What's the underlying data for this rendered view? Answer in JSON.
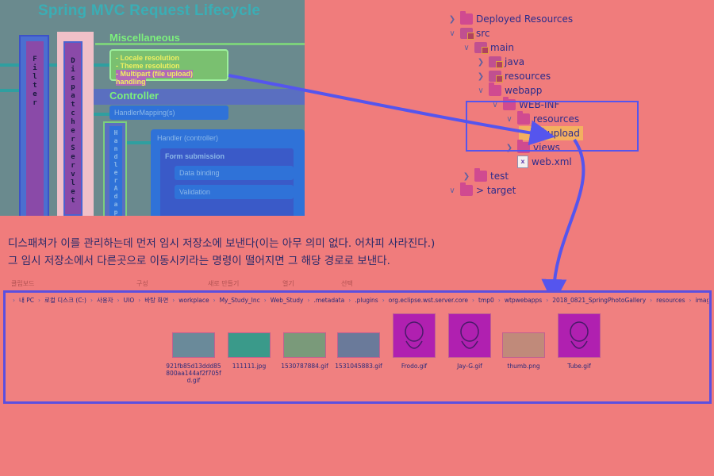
{
  "diagram": {
    "title": "Spring MVC Request Lifecycle",
    "filter_label": "Filter",
    "dispatcher_label": "DispatcherServlet",
    "misc_heading": "Miscellaneous",
    "misc_items": [
      "- Locale resolution",
      "- Theme resolution",
      "- Multipart (file upload) handling"
    ],
    "controller_heading": "Controller",
    "handler_mapping": "HandlerMapping(s)",
    "handler_adapter": "HandlerAdapter",
    "handler_controller": "Handler (controller)",
    "form_submission": "Form submission",
    "data_binding": "Data binding",
    "validation": "Validation"
  },
  "tree": {
    "items": [
      {
        "label": "Deployed Resources",
        "twisty": ">",
        "icon": "folder-icon"
      },
      {
        "label": "src",
        "twisty": "v",
        "icon": "package-folder-icon"
      },
      {
        "label": "main",
        "twisty": "v",
        "icon": "package-folder-icon"
      },
      {
        "label": "java",
        "twisty": ">",
        "icon": "package-folder-icon"
      },
      {
        "label": "resources",
        "twisty": ">",
        "icon": "package-folder-icon"
      },
      {
        "label": "webapp",
        "twisty": "v",
        "icon": "folder-icon"
      },
      {
        "label": "WEB-INF",
        "twisty": "v",
        "icon": "folder-icon"
      },
      {
        "label": "resources",
        "twisty": "v",
        "icon": "folder-icon"
      },
      {
        "label": "upload",
        "twisty": "",
        "icon": "folder-icon",
        "selected": true
      },
      {
        "label": "views",
        "twisty": ">",
        "icon": "folder-icon"
      },
      {
        "label": "web.xml",
        "twisty": "",
        "icon": "xml-file-icon"
      },
      {
        "label": "test",
        "twisty": ">",
        "icon": "folder-icon"
      },
      {
        "label": "> target",
        "twisty": "v",
        "icon": "folder-icon"
      }
    ]
  },
  "note": {
    "line1": "디스패쳐가 이를 관리하는데 먼저 임시 저장소에 보낸다(이는 아무 의미 없다. 어차피 사라진다.)",
    "line2": "그 임시 저장소에서 다른곳으로 이동시키라는 명령이 떨어지면 그 해당 경로로 보낸다."
  },
  "ribbon": [
    "클립보드",
    "구성",
    "새로 만들기",
    "열기",
    "선택"
  ],
  "explorer": {
    "path": [
      "내 PC",
      "로컬 디스크 (C:)",
      "사용자",
      "UIO",
      "바탕 화면",
      "workplace",
      "My_Study_Inc",
      "Web_Study",
      ".metadata",
      ".plugins",
      "org.eclipse.wst.server.core",
      "tmp0",
      "wtpwebapps",
      "2018_0821_SpringPhotoGallery",
      "resources",
      "image"
    ],
    "files": [
      {
        "name": "921fb85d13ddd85800aa144af2f705fd.gif",
        "thumb": "#6a8a9a"
      },
      {
        "name": "111111.jpg",
        "thumb": "#3a9a8a"
      },
      {
        "name": "1530787884.gif",
        "thumb": "#7a9a7a"
      },
      {
        "name": "1531045883.gif",
        "thumb": "#6a7a9a"
      },
      {
        "name": "Frodo.gif",
        "thumb": "#b020b0"
      },
      {
        "name": "Jay-G.gif",
        "thumb": "#b020b0"
      },
      {
        "name": "thumb.png",
        "thumb": "#c08a7a"
      },
      {
        "name": "Tube.gif",
        "thumb": "#b020b0"
      }
    ]
  },
  "colors": {
    "annotation_arrow": "#5555ee",
    "annotation_box": "#5555ee"
  }
}
